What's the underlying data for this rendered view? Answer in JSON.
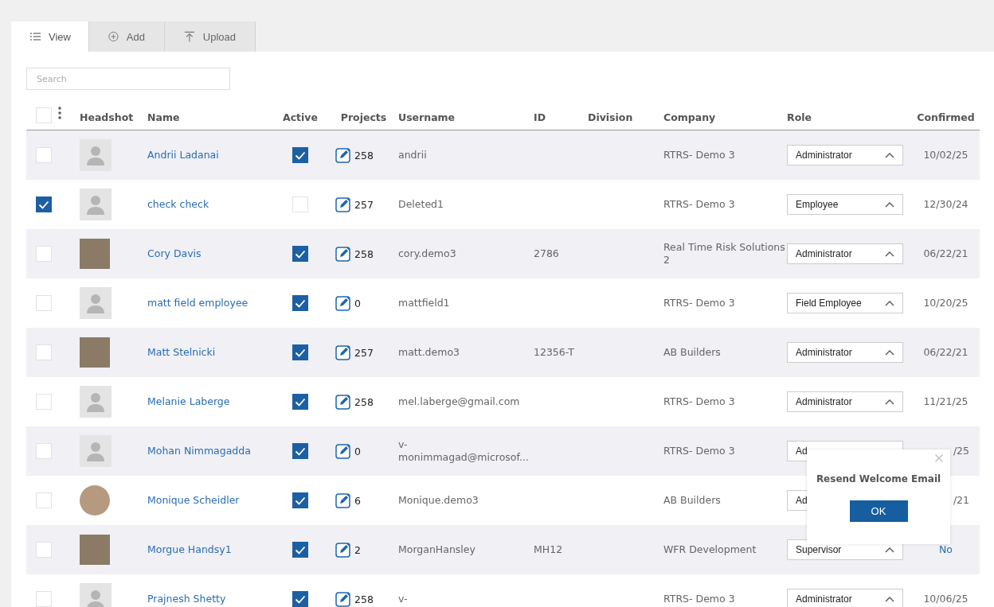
{
  "tabs": [
    {
      "label": "View",
      "selected": true
    },
    {
      "label": "Add",
      "selected": false
    },
    {
      "label": "Upload",
      "selected": false
    }
  ],
  "search": {
    "placeholder": "Search"
  },
  "table": {
    "select_all": {
      "checked": false
    },
    "columns": [
      "Headshot",
      "Name",
      "Active",
      "Projects",
      "Username",
      "ID",
      "Division",
      "Company",
      "Role",
      "Confirmed"
    ],
    "rows": [
      {
        "selected": false,
        "headshot": {
          "kind": "default"
        },
        "name": "Andrii Ladanai",
        "active": true,
        "projects": "258",
        "username": "andrii",
        "id": "",
        "company": "RTRS- Demo 3",
        "role": "Administrator",
        "confirmed": {
          "text": "10/02/25",
          "kind": "date"
        },
        "covered": false
      },
      {
        "selected": true,
        "headshot": {
          "kind": "default"
        },
        "name": "check check",
        "active": false,
        "projects": "257",
        "username": "Deleted1",
        "id": "",
        "company": "RTRS- Demo 3",
        "role": "Employee",
        "confirmed": {
          "text": "12/30/24",
          "kind": "date"
        },
        "covered": false
      },
      {
        "selected": false,
        "headshot": {
          "kind": "photo"
        },
        "name": "Cory Davis",
        "active": true,
        "projects": "258",
        "username": "cory.demo3",
        "id": "2786",
        "company": "Real Time Risk Solutions 2",
        "role": "Administrator",
        "confirmed": {
          "text": "06/22/21",
          "kind": "date"
        },
        "covered": false
      },
      {
        "selected": false,
        "headshot": {
          "kind": "default"
        },
        "name": "matt field employee",
        "active": true,
        "projects": "0",
        "username": "mattfield1",
        "id": "",
        "company": "RTRS- Demo 3",
        "role": "Field Employee",
        "confirmed": {
          "text": "10/20/25",
          "kind": "date"
        },
        "covered": false
      },
      {
        "selected": false,
        "headshot": {
          "kind": "photo"
        },
        "name": "Matt Stelnicki",
        "active": true,
        "projects": "257",
        "username": "matt.demo3",
        "id": "12356-T",
        "company": "AB Builders",
        "role": "Administrator",
        "confirmed": {
          "text": "06/22/21",
          "kind": "date"
        },
        "covered": false
      },
      {
        "selected": false,
        "headshot": {
          "kind": "default"
        },
        "name": "Melanie Laberge",
        "active": true,
        "projects": "258",
        "username": "mel.laberge@gmail.com",
        "id": "",
        "company": "RTRS- Demo 3",
        "role": "Administrator",
        "confirmed": {
          "text": "11/21/25",
          "kind": "date"
        },
        "covered": false
      },
      {
        "selected": false,
        "headshot": {
          "kind": "default"
        },
        "name": "Mohan Nimmagadda",
        "active": true,
        "projects": "0",
        "username": "v-monimmagad@microsof...",
        "id": "",
        "company": "RTRS- Demo 3",
        "role": "Ad",
        "confirmed": {
          "text": "/25",
          "kind": "date"
        },
        "covered": true
      },
      {
        "selected": false,
        "headshot": {
          "kind": "photo-round"
        },
        "name": "Monique Scheidler",
        "active": true,
        "projects": "6",
        "username": "Monique.demo3",
        "id": "",
        "company": "AB Builders",
        "role": "Ad",
        "confirmed": {
          "text": "/21",
          "kind": "date"
        },
        "covered": true
      },
      {
        "selected": false,
        "headshot": {
          "kind": "photo"
        },
        "name": "Morgue Handsy1",
        "active": true,
        "projects": "2",
        "username": "MorganHansley",
        "id": "MH12",
        "company": "WFR Development",
        "role": "Supervisor",
        "confirmed": {
          "text": "No",
          "kind": "link"
        },
        "covered": false
      },
      {
        "selected": false,
        "headshot": {
          "kind": "default"
        },
        "name": "Prajnesh Shetty",
        "active": true,
        "projects": "258",
        "username": "v-",
        "id": "",
        "company": "RTRS- Demo 3",
        "role": "Administrator",
        "confirmed": {
          "text": "10/06/25",
          "kind": "date"
        },
        "covered": false
      }
    ]
  },
  "dialog": {
    "title": "Resend Welcome Email",
    "button": "OK"
  }
}
